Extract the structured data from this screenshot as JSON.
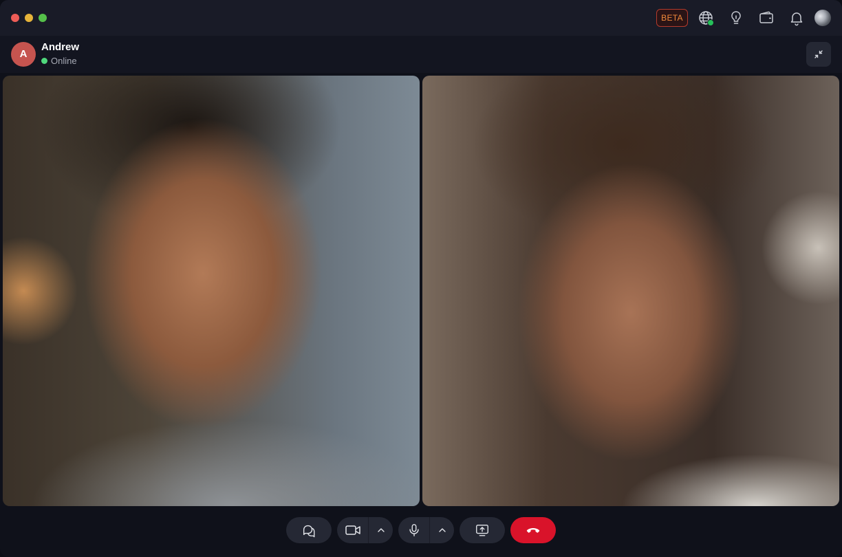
{
  "titlebar": {
    "beta_label": "BETA",
    "icons": [
      "globe-icon",
      "lightbulb-icon",
      "wallet-icon",
      "bell-icon"
    ],
    "status_color": "#26c15a"
  },
  "contact": {
    "initial": "A",
    "name": "Andrew",
    "status": "Online",
    "avatar_color": "#c6544f",
    "status_color": "#4fd87c"
  },
  "videos": {
    "remote": "video-feed-remote",
    "local": "video-feed-local"
  },
  "controls": {
    "items": [
      "chat-icon",
      "camera-icon",
      "chevron-up-icon",
      "microphone-icon",
      "chevron-up-icon",
      "screen-share-icon",
      "end-call-icon"
    ],
    "end_call_color": "#d9132a"
  }
}
